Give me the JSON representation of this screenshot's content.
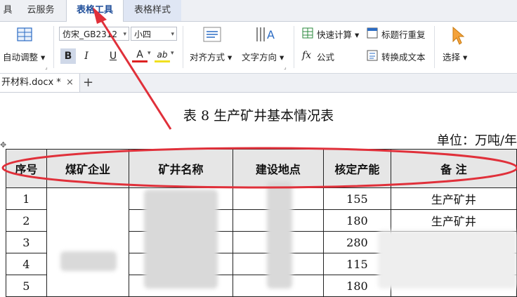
{
  "tabs": [
    {
      "label": "具"
    },
    {
      "label": "云服务"
    },
    {
      "label": "表格工具"
    },
    {
      "label": "表格样式"
    }
  ],
  "ribbon": {
    "auto_adjust": "自动调整",
    "font_name": "仿宋_GB2312",
    "font_size": "小四",
    "bold": "B",
    "italic": "I",
    "underline": "U",
    "font_color": "A",
    "highlight": "ab",
    "align": "对齐方式",
    "text_direction": "文字方向",
    "quick_calc": "快速计算",
    "header_repeat": "标题行重复",
    "formula": "公式",
    "convert_text": "转换成文本",
    "select": "选择",
    "accent_color": "#1f4e9a"
  },
  "doc_tab": {
    "name": "开材料.docx *",
    "close": "×",
    "add": "+"
  },
  "doc": {
    "title": "表 8  生产矿井基本情况表",
    "unit": "单位：万吨/年"
  },
  "table": {
    "headers": [
      "序号",
      "煤矿企业",
      "矿井名称",
      "建设地点",
      "核定产能",
      "备  注"
    ],
    "rows": [
      {
        "no": "1",
        "capacity": "155",
        "note": "生产矿井"
      },
      {
        "no": "2",
        "capacity": "180",
        "note": "生产矿井"
      },
      {
        "no": "3",
        "capacity": "280",
        "note": ""
      },
      {
        "no": "4",
        "capacity": "115",
        "note": ""
      },
      {
        "no": "5",
        "capacity": "180",
        "note": ""
      }
    ]
  },
  "annotation_color": "#e0303a"
}
